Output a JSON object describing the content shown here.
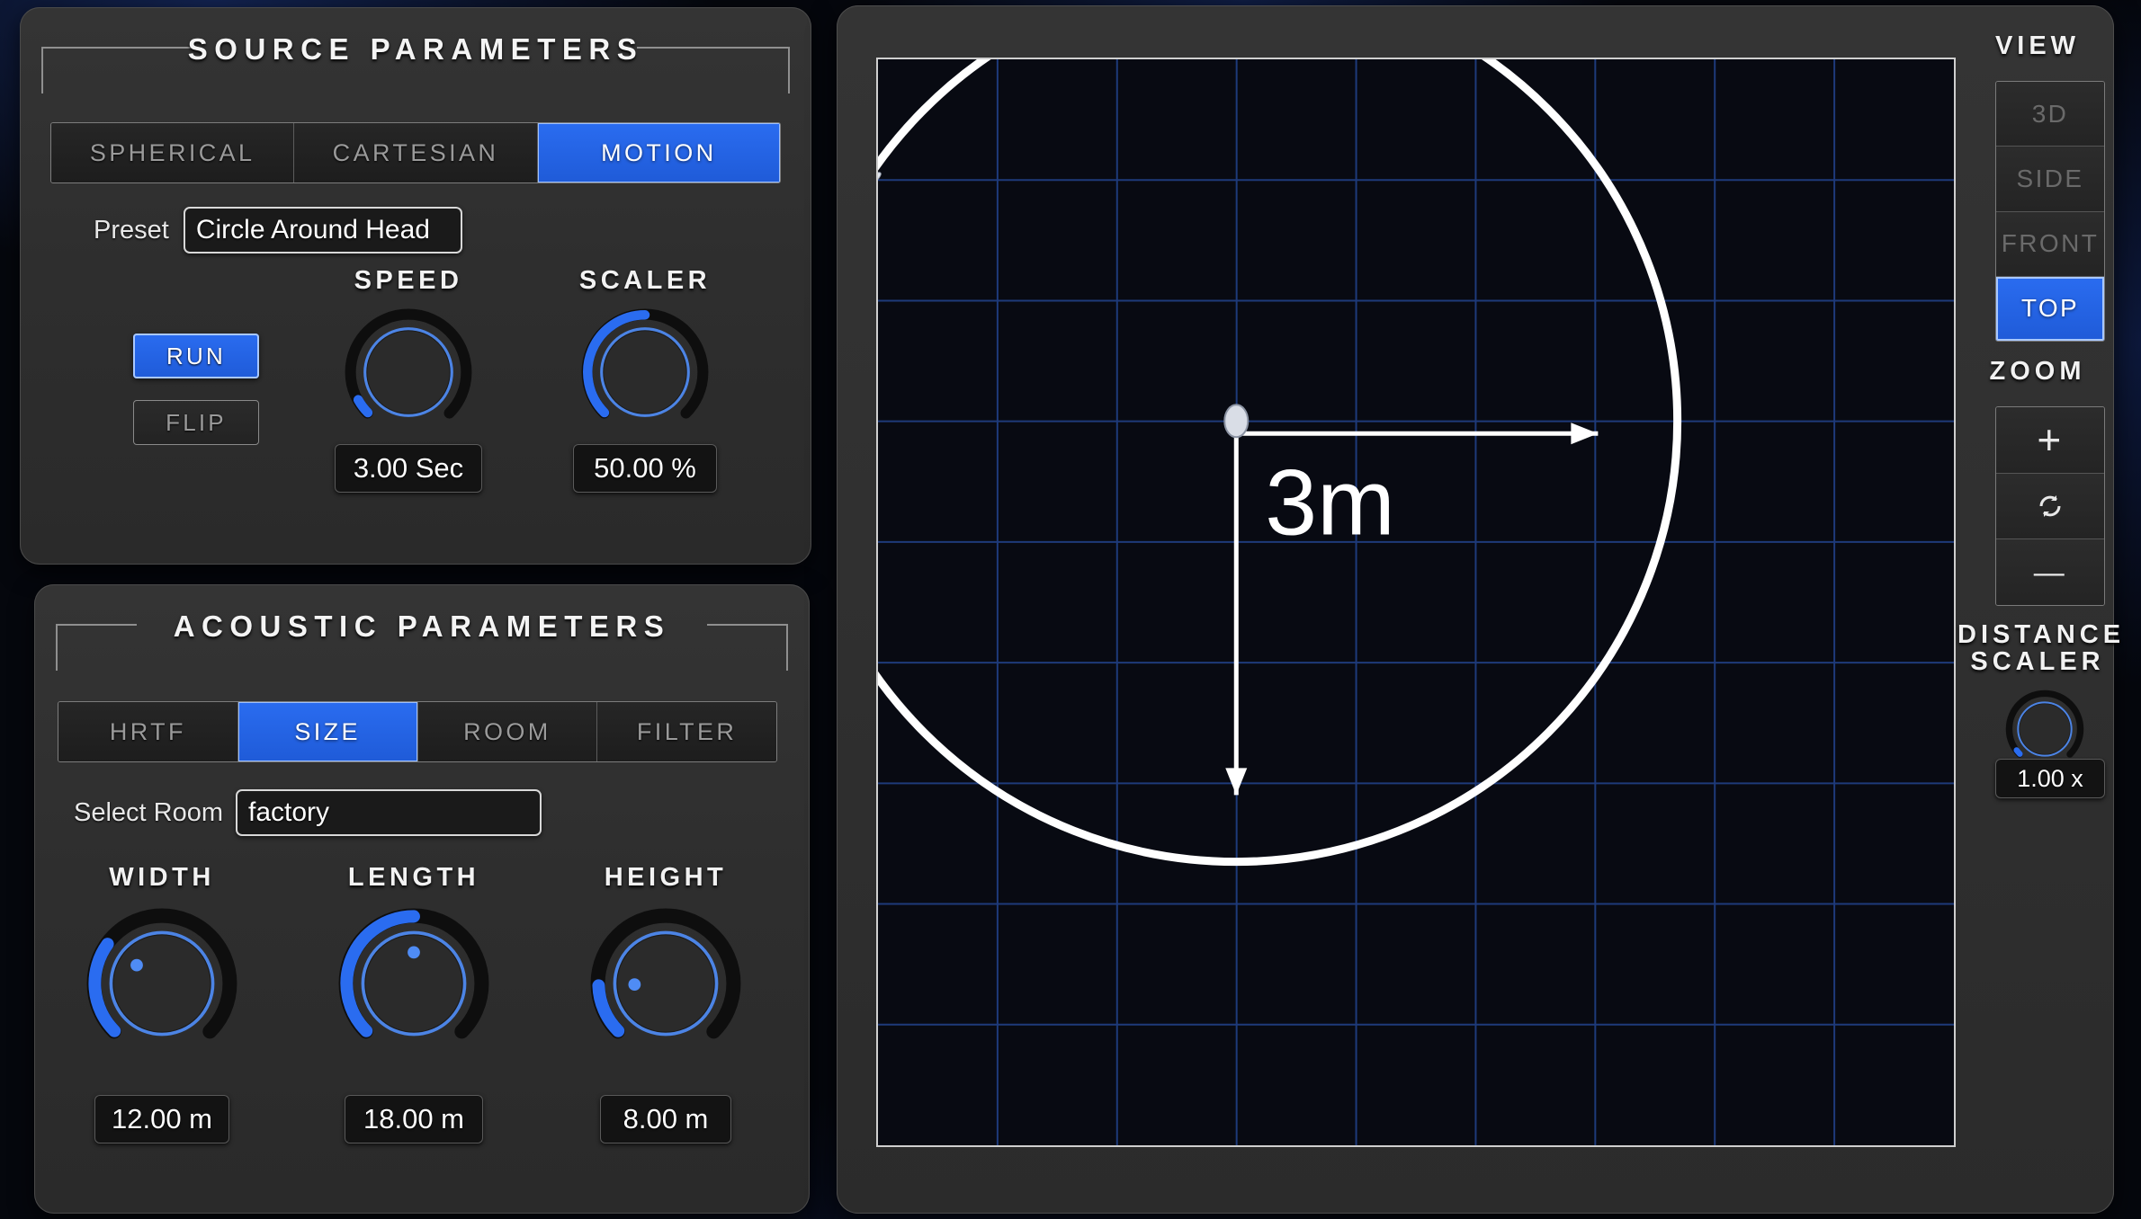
{
  "theme": {
    "accent": "#2a6cf0",
    "panel_bg": "#2e2e2e",
    "viewport_bg": "#080a12",
    "grid_color": "#1e3a7a",
    "trajectory_color": "#ffffff"
  },
  "source_panel": {
    "title": "SOURCE PARAMETERS",
    "mode_tabs": [
      {
        "label": "SPHERICAL",
        "active": false
      },
      {
        "label": "CARTESIAN",
        "active": false
      },
      {
        "label": "MOTION",
        "active": true
      }
    ],
    "preset": {
      "label": "Preset",
      "value": "Circle Around Head"
    },
    "buttons": [
      {
        "label": "RUN",
        "active": true
      },
      {
        "label": "FLIP",
        "active": false
      }
    ],
    "knobs": [
      {
        "name": "SPEED",
        "value": "3.00 Sec",
        "fraction": 0.06
      },
      {
        "name": "SCALER",
        "value": "50.00 %",
        "fraction": 0.5
      }
    ]
  },
  "acoustic_panel": {
    "title": "ACOUSTIC PARAMETERS",
    "tabs": [
      {
        "label": "HRTF",
        "active": false
      },
      {
        "label": "SIZE",
        "active": true
      },
      {
        "label": "ROOM",
        "active": false
      },
      {
        "label": "FILTER",
        "active": false
      }
    ],
    "room": {
      "label": "Select Room",
      "value": "factory"
    },
    "knobs": [
      {
        "name": "WIDTH",
        "value": "12.00 m",
        "fraction": 0.3
      },
      {
        "name": "LENGTH",
        "value": "18.00 m",
        "fraction": 0.5
      },
      {
        "name": "HEIGHT",
        "value": "8.00 m",
        "fraction": 0.16
      }
    ]
  },
  "viewport": {
    "scale_label": "3m",
    "grid_columns": 9,
    "grid_rows": 9,
    "head_marker": "listener-head",
    "source_marker": "moving-sound-source",
    "trajectory": "circle"
  },
  "right_rail": {
    "view": {
      "title": "VIEW",
      "options": [
        {
          "label": "3D",
          "active": false
        },
        {
          "label": "SIDE",
          "active": false
        },
        {
          "label": "FRONT",
          "active": false
        },
        {
          "label": "TOP",
          "active": true
        }
      ]
    },
    "zoom": {
      "title": "ZOOM",
      "buttons": [
        {
          "icon": "plus-icon",
          "label": "+"
        },
        {
          "icon": "reset-icon",
          "label": ""
        },
        {
          "icon": "minus-icon",
          "label": "—"
        }
      ]
    },
    "distance_scaler": {
      "title_line1": "DISTANCE",
      "title_line2": "SCALER",
      "value": "1.00 x",
      "fraction": 0.03
    }
  }
}
